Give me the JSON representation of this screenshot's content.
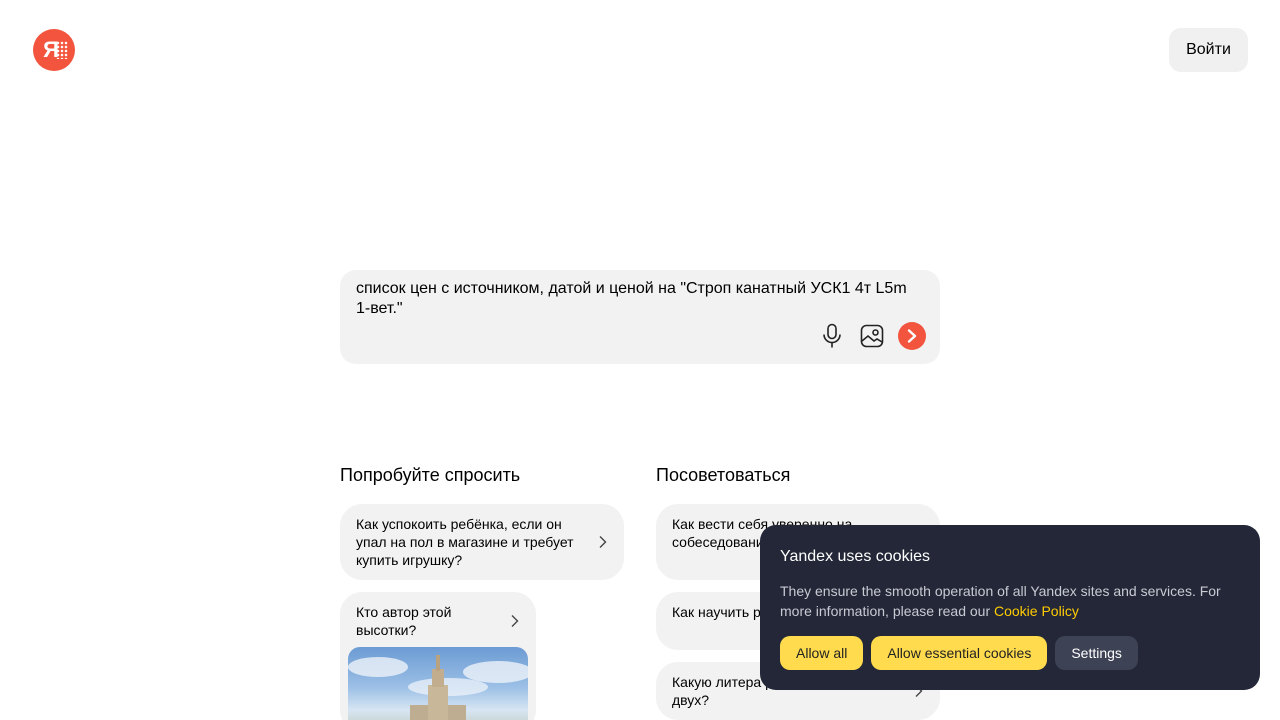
{
  "header": {
    "logo_icon": "yandex-logo-icon",
    "logo_letter": "Я",
    "login_label": "Войти"
  },
  "search": {
    "query": "список цен с источником, датой и ценой на \"Строп канатный УСК1 4т L5m 1-вет.\"",
    "icons": [
      "microphone-icon",
      "image-search-icon",
      "send-arrow-icon"
    ],
    "accent": "#f2543d"
  },
  "try_ask": {
    "title": "Попробуйте спросить",
    "cards": [
      "Как успокоить ребёнка, если он упал на пол в магазине и требует купить игрушку?",
      "Кто автор этой высотки?"
    ]
  },
  "advice": {
    "title": "Посоветоваться",
    "cards": [
      "Как вести себя уверенно на собеседовании на менеджерскую",
      "Как научить р самостоятель",
      "Какую литера ребенку с года до двух?"
    ]
  },
  "cookie_banner": {
    "title": "Yandex uses cookies",
    "text": "They ensure the smooth operation of all Yandex sites and services. For more information, please read our ",
    "link": "Cookie Policy",
    "allow_all": "Allow all",
    "allow_essential": "Allow essential cookies",
    "settings": "Settings",
    "colors": {
      "background": "#232737",
      "link": "#ffcc00",
      "primary_button": "#ffdb4d"
    }
  }
}
